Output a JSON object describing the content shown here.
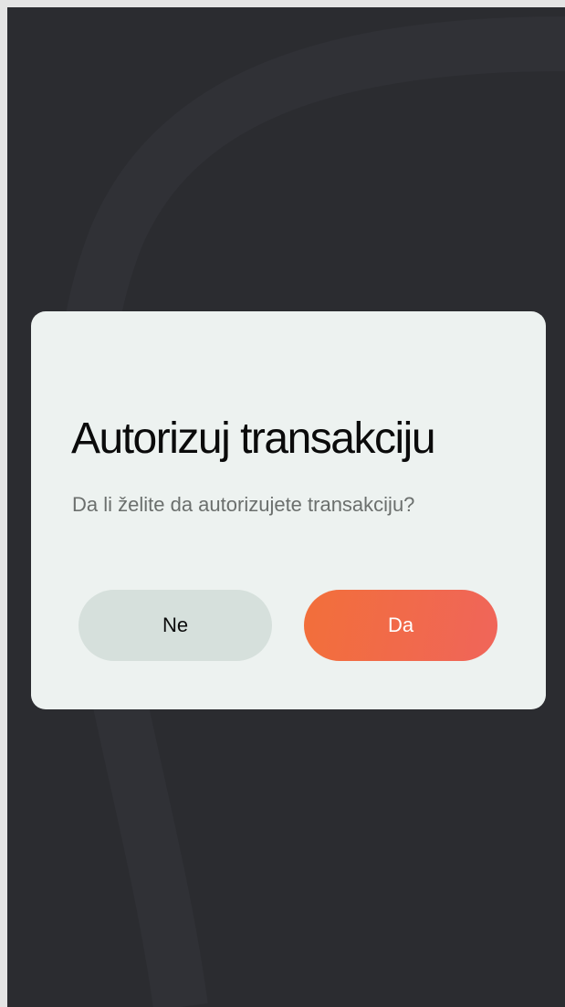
{
  "dialog": {
    "title": "Autorizuj transakciju",
    "message": "Da li želite da autorizujete transakciju?",
    "cancel_label": "Ne",
    "confirm_label": "Da"
  },
  "colors": {
    "background": "#2b2c30",
    "dialog_background": "#edf2f0",
    "cancel_button": "#d6e0dc",
    "confirm_gradient_start": "#f26f3a",
    "confirm_gradient_end": "#f0655a"
  }
}
